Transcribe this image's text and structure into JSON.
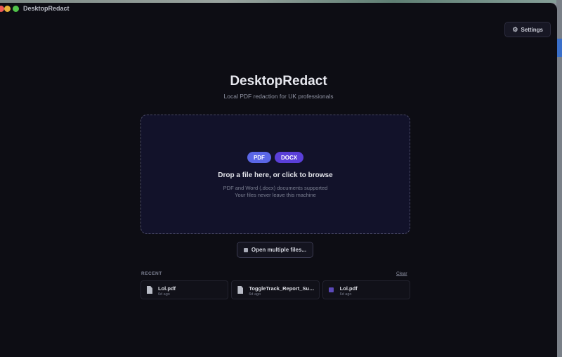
{
  "window": {
    "title": "DesktopRedact"
  },
  "header": {
    "settings_label": "Settings",
    "settings_icon": "gear-icon"
  },
  "hero": {
    "title": "DesktopRedact",
    "subtitle": "Local PDF redaction for UK professionals"
  },
  "dropzone": {
    "chips": [
      "PDF",
      "DOCX"
    ],
    "main_text": "Drop a file here, or click to browse",
    "sub_text_1": "PDF and Word (.docx) documents supported",
    "sub_text_2": "Your files never leave this machine"
  },
  "open_multiple": {
    "label": "Open multiple files..."
  },
  "recent": {
    "heading": "RECENT",
    "clear_label": "Clear",
    "items": [
      {
        "name": "Lol.pdf",
        "meta": "6d ago",
        "icon": "file-icon"
      },
      {
        "name": "ToggleTrack_Report_Summary.pdf",
        "meta": "6d ago",
        "icon": "file-icon"
      },
      {
        "name": "Lol.pdf",
        "meta": "6d ago",
        "icon": "word-file-icon"
      }
    ]
  },
  "colors": {
    "background": "#0d0d14",
    "dropzone_bg": "#12122a",
    "pdf_chip": "#5b67e6",
    "docx_chip": "#5a3fd8"
  }
}
